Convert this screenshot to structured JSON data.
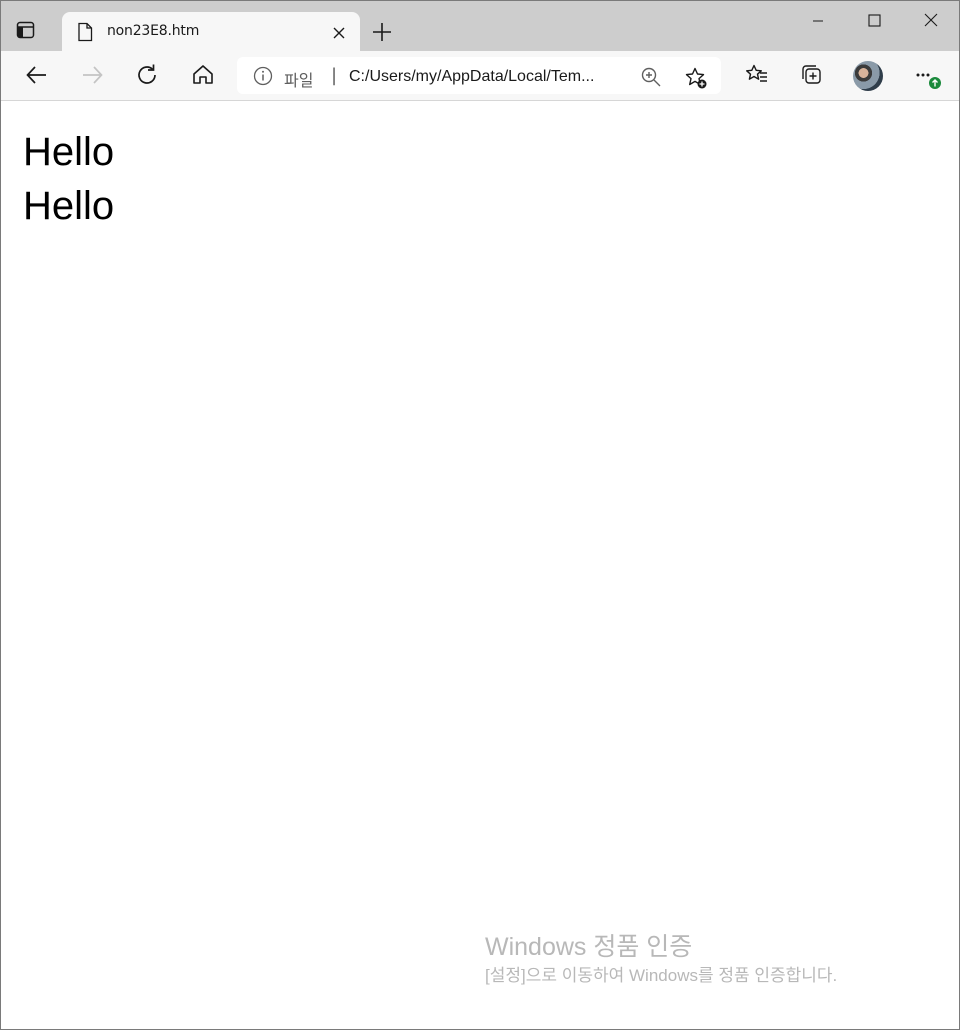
{
  "tab": {
    "title": "non23E8.htm"
  },
  "address_bar": {
    "scheme_label": "파일",
    "separator": "|",
    "url": "C:/Users/my/AppData/Local/Tem..."
  },
  "page": {
    "lines": [
      "Hello",
      "Hello"
    ]
  },
  "watermark": {
    "title": "Windows 정품 인증",
    "subtitle": "[설정]으로 이동하여 Windows를 정품 인증합니다."
  },
  "icons": {
    "tab_actions": "tab-actions-icon",
    "file": "file-icon",
    "tab_close": "close-icon",
    "new_tab": "plus-icon",
    "minimize": "minimize-icon",
    "maximize": "maximize-icon",
    "window_close": "close-icon",
    "back": "back-arrow-icon",
    "forward": "forward-arrow-icon",
    "refresh": "refresh-icon",
    "home": "home-icon",
    "info": "info-icon",
    "zoom": "zoom-in-icon",
    "add_favorite": "add-favorite-icon",
    "favorites": "favorites-icon",
    "collections": "collections-icon",
    "profile": "avatar",
    "settings_more": "more-icon"
  },
  "colors": {
    "tabstrip_bg": "#cdcdcd",
    "toolbar_bg": "#f7f7f7",
    "update_badge": "#1b8a3c",
    "watermark_text": "#b8b8b8"
  }
}
